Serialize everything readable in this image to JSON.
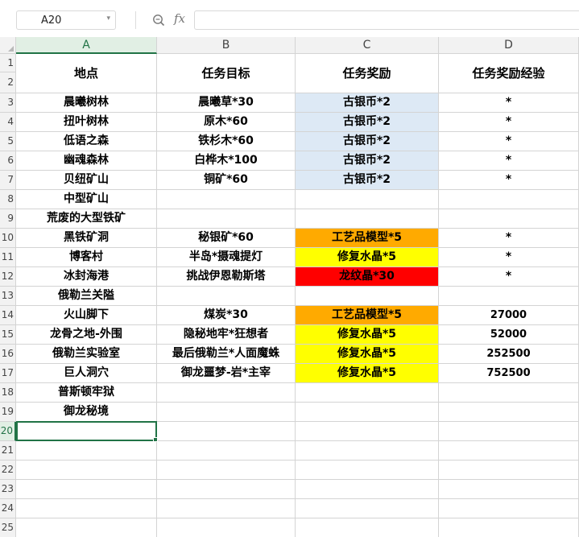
{
  "formula_bar": {
    "cell_ref": "A20",
    "formula": "",
    "fx_label": "fx"
  },
  "columns": [
    "A",
    "B",
    "C",
    "D"
  ],
  "rows": [
    "1",
    "2",
    "3",
    "4",
    "5",
    "6",
    "7",
    "8",
    "9",
    "10",
    "11",
    "12",
    "13",
    "14",
    "15",
    "16",
    "17",
    "18",
    "19",
    "20",
    "21",
    "22",
    "23",
    "24",
    "25"
  ],
  "selected": {
    "column": "A",
    "row": "20"
  },
  "header": [
    "地点",
    "任务目标",
    "任务奖励",
    "任务奖励经验"
  ],
  "data_rows": [
    [
      "晨曦树林",
      "晨曦草*30",
      "古银币*2",
      "*"
    ],
    [
      "扭叶树林",
      "原木*60",
      "古银币*2",
      "*"
    ],
    [
      "低语之森",
      "铁杉木*60",
      "古银币*2",
      "*"
    ],
    [
      "幽魂森林",
      "白桦木*100",
      "古银币*2",
      "*"
    ],
    [
      "贝纽矿山",
      "铜矿*60",
      "古银币*2",
      "*"
    ],
    [
      "中型矿山",
      "",
      "",
      ""
    ],
    [
      "荒废的大型铁矿",
      "",
      "",
      ""
    ],
    [
      "黑铁矿洞",
      "秘银矿*60",
      "工艺品模型*5",
      "*"
    ],
    [
      "博客村",
      "半岛*摄魂提灯",
      "修复水晶*5",
      "*"
    ],
    [
      "冰封海港",
      "挑战伊恩勒斯塔",
      "龙纹晶*30",
      "*"
    ],
    [
      "俄勒兰关隘",
      "",
      "",
      ""
    ],
    [
      "火山脚下",
      "煤炭*30",
      "工艺品模型*5",
      "27000"
    ],
    [
      "龙骨之地-外围",
      "隐秘地牢*狂想者",
      "修复水晶*5",
      "52000"
    ],
    [
      "俄勒兰实验室",
      "最后俄勒兰*人面魔蛛",
      "修复水晶*5",
      "252500"
    ],
    [
      "巨人洞穴",
      "御龙噩梦-岩*主宰",
      "修复水晶*5",
      "752500"
    ],
    [
      "普斯顿牢狱",
      "",
      "",
      ""
    ],
    [
      "御龙秘境",
      "",
      "",
      ""
    ]
  ],
  "fills": {
    "blue": "#dde9f5",
    "orange": "#ffaa00",
    "yellow": "#ffff00",
    "red": "#ff0000",
    "selection_green": "#217346"
  },
  "reward_fill": [
    "blue",
    "blue",
    "blue",
    "blue",
    "blue",
    "",
    "",
    "orange",
    "yellow",
    "red",
    "",
    "orange",
    "yellow",
    "yellow",
    "yellow",
    "",
    ""
  ]
}
